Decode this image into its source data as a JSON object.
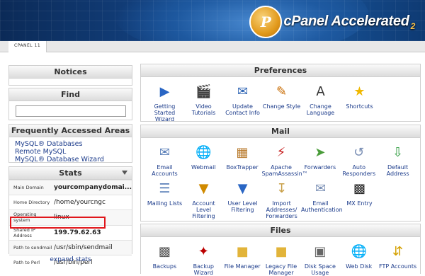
{
  "header": {
    "brand_letter": "P",
    "brand_name": "cPanel Accelerated",
    "brand_version": "2",
    "tab_label": "CPANEL 11"
  },
  "left": {
    "notices_title": "Notices",
    "find_title": "Find",
    "faa_title": "Frequently Accessed Areas",
    "faa_links": [
      "MySQL® Databases",
      "Remote MySQL",
      "MySQL® Database Wizard"
    ],
    "stats_title": "Stats",
    "stats": [
      {
        "key": "Main Domain",
        "value": "yourcompanydomai..."
      },
      {
        "key": "Home Directory",
        "value": "/home/yourcngc"
      },
      {
        "key": "Operating system",
        "value": "linux"
      },
      {
        "key": "Shared IP Address",
        "value": "199.79.62.63"
      },
      {
        "key": "Path to sendmail",
        "value": "/usr/sbin/sendmail"
      },
      {
        "key": "Path to Perl",
        "value": "/usr/bin/perl"
      }
    ],
    "expand_label": "expand stats"
  },
  "right": {
    "preferences_title": "Preferences",
    "preferences": [
      {
        "label": "Getting Started Wizard",
        "icon": "play-circle-icon"
      },
      {
        "label": "Video Tutorials",
        "icon": "film-clapper-icon"
      },
      {
        "label": "Update Contact Info",
        "icon": "contact-card-icon"
      },
      {
        "label": "Change Style",
        "icon": "paint-brush-icon"
      },
      {
        "label": "Change Language",
        "icon": "language-icon"
      },
      {
        "label": "Shortcuts",
        "icon": "star-icon"
      }
    ],
    "mail_title": "Mail",
    "mail_row1": [
      {
        "label": "Email Accounts",
        "icon": "envelope-icon"
      },
      {
        "label": "Webmail",
        "icon": "globe-mail-icon"
      },
      {
        "label": "BoxTrapper",
        "icon": "box-trap-icon"
      },
      {
        "label": "Apache SpamAssassin™",
        "icon": "spamassassin-icon"
      },
      {
        "label": "Forwarders",
        "icon": "forward-mail-icon"
      },
      {
        "label": "Auto Responders",
        "icon": "autoresponder-icon"
      },
      {
        "label": "Default Address",
        "icon": "default-address-icon"
      }
    ],
    "mail_row2": [
      {
        "label": "Mailing Lists",
        "icon": "mailing-list-icon"
      },
      {
        "label": "Account Level Filtering",
        "icon": "filter-icon"
      },
      {
        "label": "User Level Filtering",
        "icon": "user-filter-icon"
      },
      {
        "label": "Import Addresses/ Forwarders",
        "icon": "import-icon"
      },
      {
        "label": "Email Authentication",
        "icon": "email-auth-icon"
      },
      {
        "label": "MX Entry",
        "icon": "mx-entry-icon"
      }
    ],
    "files_title": "Files",
    "files": [
      {
        "label": "Backups",
        "icon": "backup-icon"
      },
      {
        "label": "Backup Wizard",
        "icon": "backup-wizard-icon"
      },
      {
        "label": "File Manager",
        "icon": "folder-icon"
      },
      {
        "label": "Legacy File Manager",
        "icon": "legacy-folder-icon"
      },
      {
        "label": "Disk Space Usage",
        "icon": "disk-usage-icon"
      },
      {
        "label": "Web Disk",
        "icon": "web-disk-icon"
      },
      {
        "label": "FTP Accounts",
        "icon": "ftp-icon"
      }
    ]
  },
  "colors": {
    "highlight": "#e0161b",
    "link": "#1a3a8a"
  }
}
